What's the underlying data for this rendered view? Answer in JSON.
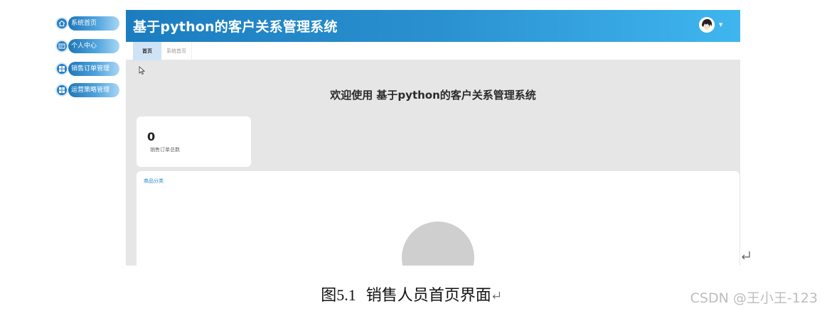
{
  "app": {
    "title": "基于python的客户关系管理系统"
  },
  "sidebar": {
    "items": [
      {
        "label": "系统首页",
        "icon": "home-icon"
      },
      {
        "label": "个人中心",
        "icon": "id-card-icon"
      },
      {
        "label": "销售订单管理",
        "icon": "grid-icon"
      },
      {
        "label": "运营策略管理",
        "icon": "grid-icon"
      }
    ]
  },
  "tabs": [
    {
      "label": "首页",
      "active": true
    },
    {
      "label": "系统首页",
      "active": false
    }
  ],
  "main": {
    "welcome": "欢迎使用 基于python的客户关系管理系统",
    "stat": {
      "value": "0",
      "label": "销售订单总数"
    },
    "panel_title": "商品分类"
  },
  "caption": {
    "prefix": "图",
    "number": "5.1",
    "text": "销售人员首页界面"
  },
  "watermark": "CSDN @王小王-123",
  "colors": {
    "header_start": "#1b7dc0",
    "header_end": "#3fb6ef",
    "main_bg": "#e6e6e6",
    "tab_active": "#cfe3f6"
  }
}
